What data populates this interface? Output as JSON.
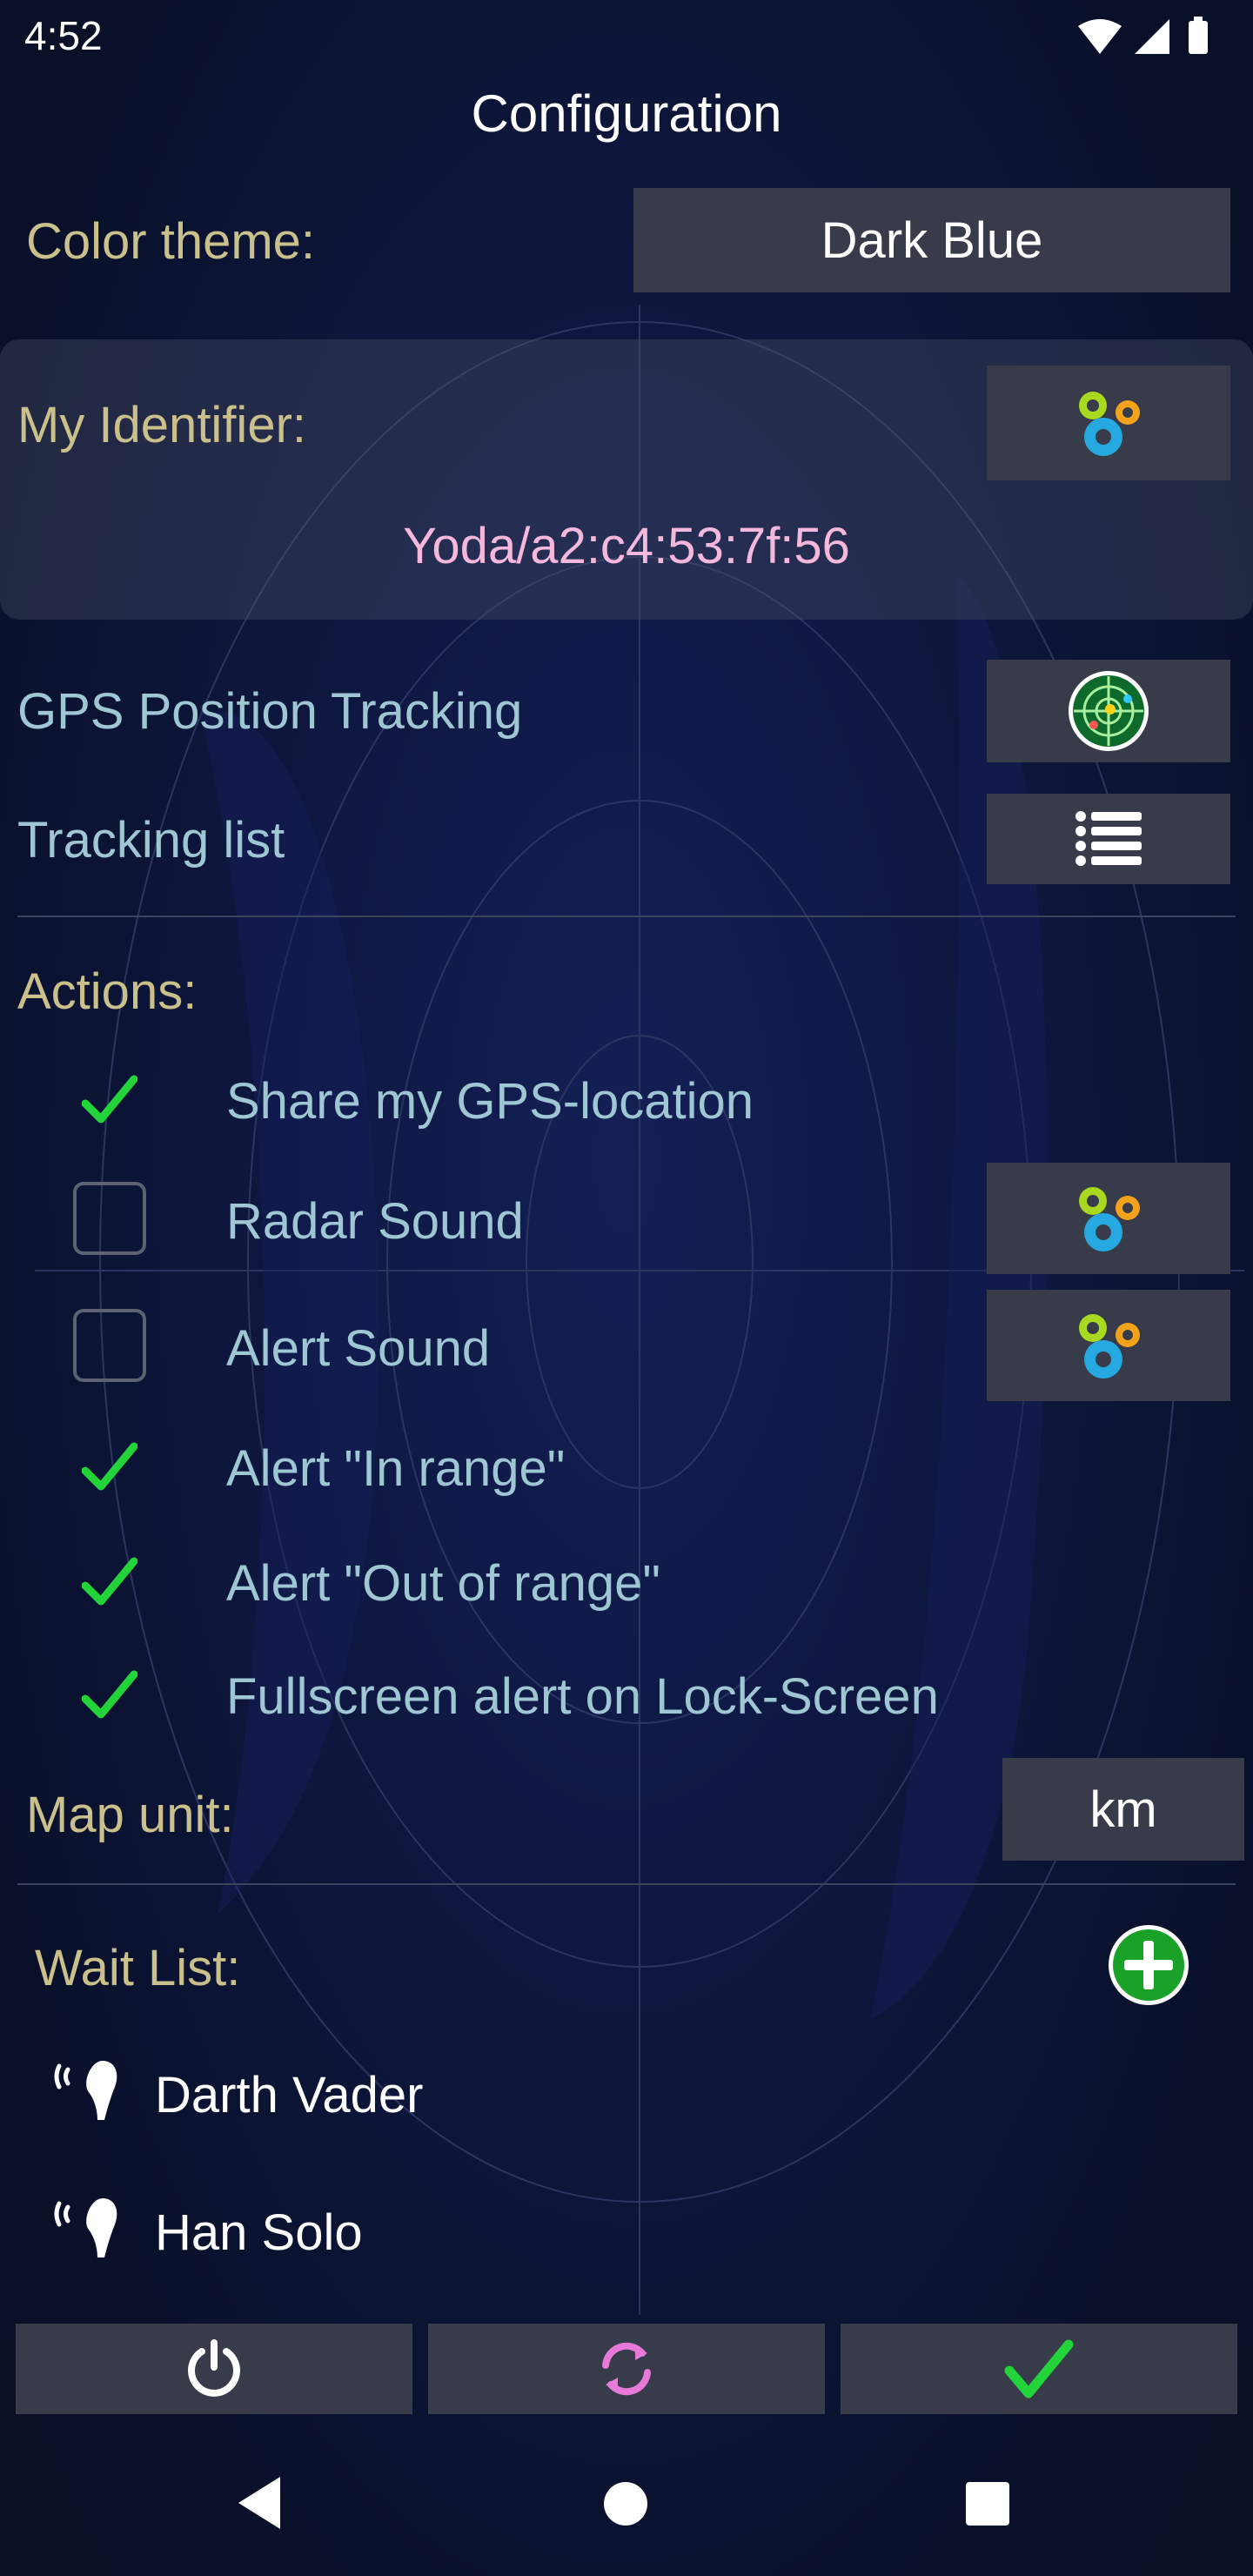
{
  "status_bar": {
    "time": "4:52",
    "icons": [
      "wifi-icon",
      "cell-signal-icon",
      "battery-icon"
    ]
  },
  "title": "Configuration",
  "color_theme": {
    "label": "Color theme:",
    "value": "Dark Blue"
  },
  "identifier": {
    "label": "My Identifier:",
    "value": "Yoda/a2:c4:53:7f:56",
    "button_icon": "gears-icon"
  },
  "gps_tracking": {
    "label": "GPS Position Tracking",
    "button_icon": "radar-icon"
  },
  "tracking_list": {
    "label": "Tracking list",
    "button_icon": "list-icon"
  },
  "actions": {
    "label": "Actions:",
    "items": [
      {
        "label": "Share my GPS-location",
        "checked": true
      },
      {
        "label": "Radar Sound",
        "checked": false,
        "settings_icon": "gears-icon"
      },
      {
        "label": "Alert Sound",
        "checked": false,
        "settings_icon": "gears-icon"
      },
      {
        "label": "Alert \"In range\"",
        "checked": true
      },
      {
        "label": "Alert \"Out of range\"",
        "checked": true
      },
      {
        "label": "Fullscreen alert on Lock-Screen",
        "checked": true
      }
    ]
  },
  "map_unit": {
    "label": "Map unit:",
    "value": "km"
  },
  "wait_list": {
    "label": "Wait List:",
    "add_icon": "add-icon",
    "items": [
      {
        "name": "Darth Vader",
        "icon": "signal-person-icon"
      },
      {
        "name": "Han Solo",
        "icon": "signal-person-icon"
      }
    ]
  },
  "bottom_bar": {
    "icons": [
      "power-icon",
      "refresh-icon",
      "check-icon"
    ]
  },
  "nav_bar": {
    "icons": [
      "back-icon",
      "home-icon",
      "recents-icon"
    ]
  },
  "colors": {
    "background": "#0b1230",
    "button": "#383c4a",
    "label_yellow": "#c9c08c",
    "label_teal": "#9fc6d3",
    "identifier_pink": "#f4b8dd",
    "check_green": "#22d33a",
    "refresh_pink": "#e77ad8"
  }
}
